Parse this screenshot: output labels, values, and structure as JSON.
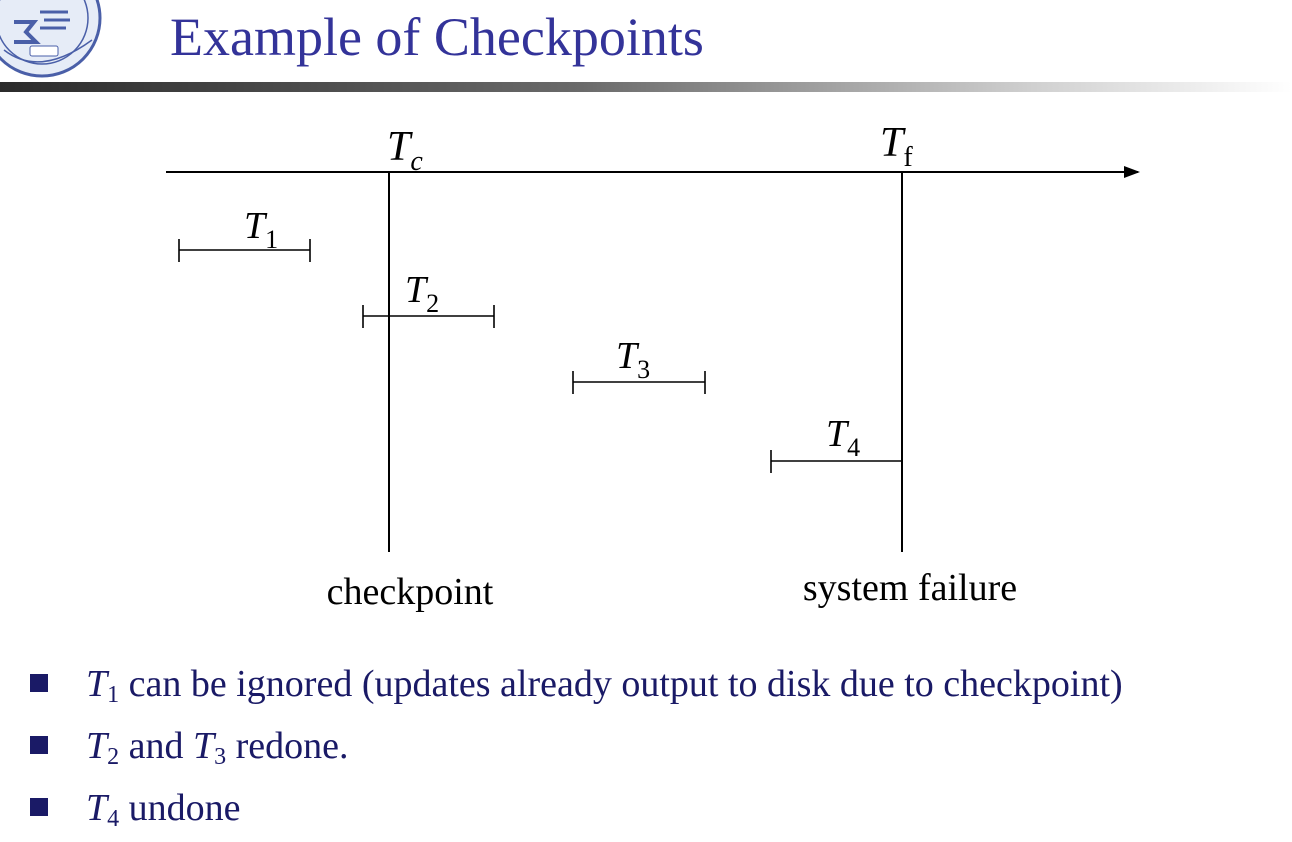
{
  "slide": {
    "title": "Example of Checkpoints"
  },
  "diagram": {
    "checkpoint_marker": {
      "symbol": "T",
      "subscript": "c"
    },
    "failure_marker": {
      "symbol": "T",
      "subscript": "f"
    },
    "checkpoint_label": "checkpoint",
    "failure_label": "system failure",
    "transactions": [
      {
        "symbol": "T",
        "subscript": "1"
      },
      {
        "symbol": "T",
        "subscript": "2"
      },
      {
        "symbol": "T",
        "subscript": "3"
      },
      {
        "symbol": "T",
        "subscript": "4"
      }
    ]
  },
  "bullets": [
    {
      "symbol": "T",
      "subscript": "1",
      "text": " can be ignored (updates already output to disk due to checkpoint)"
    },
    {
      "symbol": "T",
      "subscript": "2",
      "middle": " and ",
      "symbol2": "T",
      "subscript2": "3",
      "text": " redone."
    },
    {
      "symbol": "T",
      "subscript": "4",
      "text": " undone"
    }
  ],
  "colors": {
    "title": "#333399",
    "bullet_text": "#1a1a66",
    "diagram_lines": "#000000"
  }
}
